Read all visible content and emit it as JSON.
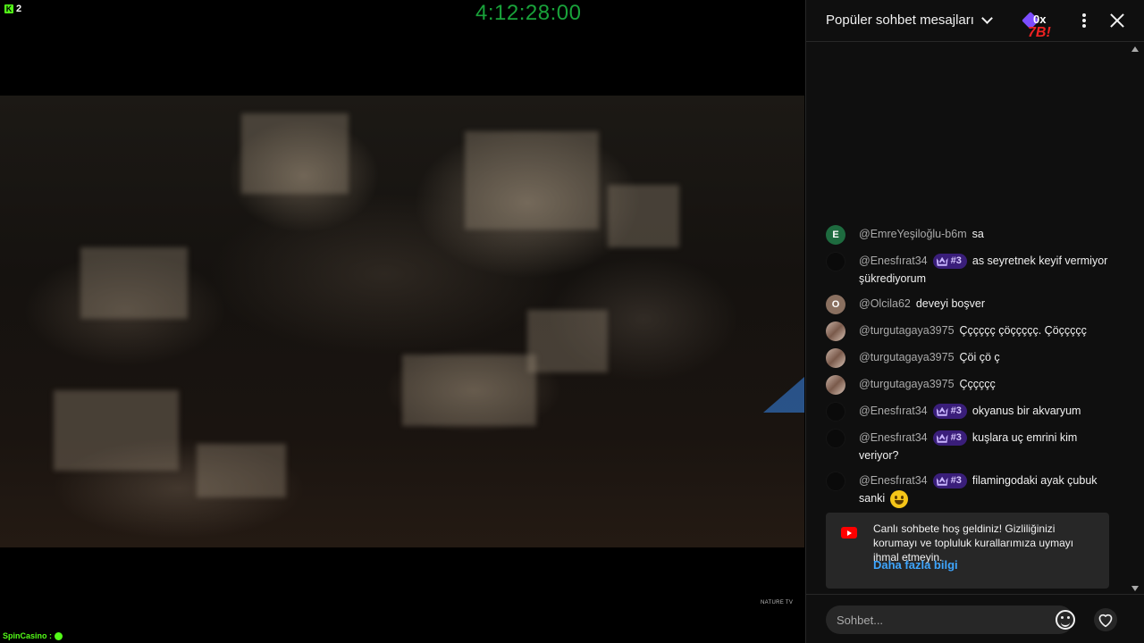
{
  "video": {
    "kick_count": "2",
    "timer": "4:12:28:00",
    "overlay_brand": "NATURE TV",
    "sponsor": "SpinCasino :"
  },
  "chat": {
    "header_title": "Popüler sohbet mesajları",
    "overlay_text": "0x",
    "overlay_text_red": "7B!",
    "messages": [
      {
        "avatar_letter": "E",
        "avatar_style": "av-green",
        "author": "@EmreYeşiloğlu-b6m",
        "badge": "",
        "text": "sa"
      },
      {
        "avatar_letter": "",
        "avatar_style": "av-dark",
        "author": "@Enesfırat34",
        "badge": "#3",
        "text": "as seyretnek keyif vermiyor şükrediyorum"
      },
      {
        "avatar_letter": "O",
        "avatar_style": "av-brown",
        "author": "@Olcila62",
        "badge": "",
        "text": "deveyi boşver"
      },
      {
        "avatar_letter": "",
        "avatar_style": "av-photo",
        "author": "@turgutagaya3975",
        "badge": "",
        "text": "Çççççç çöççççç. Çöççççç"
      },
      {
        "avatar_letter": "",
        "avatar_style": "av-photo",
        "author": "@turgutagaya3975",
        "badge": "",
        "text": "Çöi çö ç"
      },
      {
        "avatar_letter": "",
        "avatar_style": "av-photo",
        "author": "@turgutagaya3975",
        "badge": "",
        "text": "Çççççç"
      },
      {
        "avatar_letter": "",
        "avatar_style": "av-dark",
        "author": "@Enesfırat34",
        "badge": "#3",
        "text": "okyanus bir akvaryum"
      },
      {
        "avatar_letter": "",
        "avatar_style": "av-dark",
        "author": "@Enesfırat34",
        "badge": "#3",
        "text": "kuşlara uç emrini kim veriyor?"
      },
      {
        "avatar_letter": "",
        "avatar_style": "av-dark",
        "author": "@Enesfırat34",
        "badge": "#3",
        "text": "filamingodaki ayak çubuk sanki",
        "emoji": "grinning-face"
      }
    ],
    "welcome": {
      "text": "Canlı sohbete hoş geldiniz! Gizliliğinizi korumayı ve topluluk kurallarımıza uymayı ihmal etmeyin.",
      "link": "Daha fazla bilgi"
    },
    "input": {
      "placeholder": "Sohbet..."
    }
  },
  "colors": {
    "timer": "#19a23a",
    "badge_bg": "#3a1e7a",
    "link": "#3ea6ff",
    "yt_red": "#ff0000",
    "kick_green": "#53fc18"
  }
}
